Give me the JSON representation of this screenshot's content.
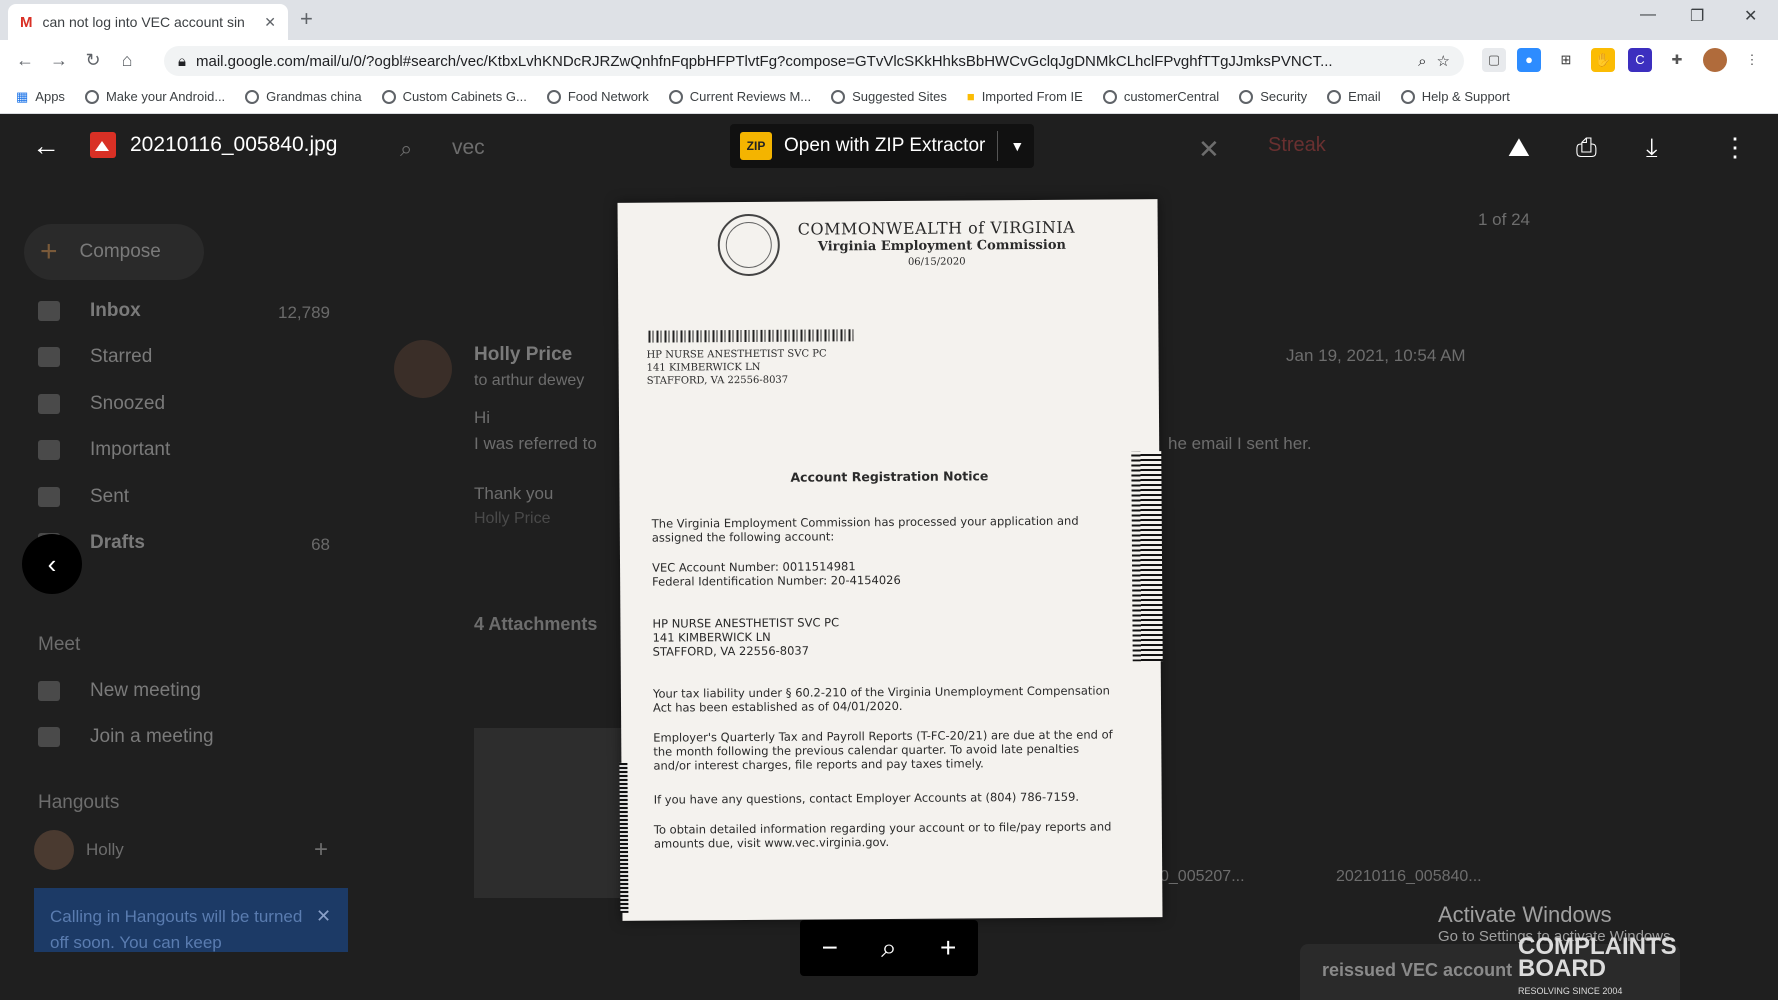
{
  "browser": {
    "tab_title": "can not log into VEC account sin",
    "gmail_mark": "M",
    "url": "mail.google.com/mail/u/0/?ogbl#search/vec/KtbxLvhKNDcRJRZwQnhfnFqpbHFPTlvtFg?compose=GTvVlcSKkHhksBbHWCvGclqJgDNMkCLhclFPvghfTTgJJmksPVNCT...",
    "bookmarks": [
      "Apps",
      "Make your Android...",
      "Grandmas china",
      "Custom Cabinets G...",
      "Food Network",
      "Current Reviews M...",
      "Suggested Sites",
      "Imported From IE",
      "customerCentral",
      "Security",
      "Email",
      "Help & Support"
    ]
  },
  "gmail": {
    "compose": "Compose",
    "nav": [
      {
        "label": "Inbox",
        "count": "12,789"
      },
      {
        "label": "Starred",
        "count": ""
      },
      {
        "label": "Snoozed",
        "count": ""
      },
      {
        "label": "Important",
        "count": ""
      },
      {
        "label": "Sent",
        "count": ""
      },
      {
        "label": "Drafts",
        "count": "68"
      }
    ],
    "meet": "Meet",
    "new_meeting": "New meeting",
    "join_meeting": "Join a meeting",
    "hangouts": "Hangouts",
    "hangouts_user": "Holly",
    "hangouts_banner": "Calling in Hangouts will be turned off soon. You can keep",
    "search_value": "vec",
    "sender": "Holly Price",
    "to": "to arthur dewey",
    "date": "Jan 19, 2021, 10:54 AM",
    "pagination": "1 of 24",
    "body_hi": "Hi",
    "body_line": "I was referred to",
    "body_line_end": "he email I sent her.",
    "thanks": "Thank you",
    "sig": "Holly Price",
    "attachments": "4 Attachments",
    "attach_name1": "0_005207...",
    "attach_name2": "20210116_005840...",
    "draft_title": "reissued VEC account"
  },
  "viewer": {
    "filename": "20210116_005840.jpg",
    "open_with": "Open with ZIP Extractor",
    "zip_icon": "ZIP"
  },
  "document": {
    "hdr1": "COMMONWEALTH of VIRGINIA",
    "hdr2": "Virginia Employment Commission",
    "date": "06/15/2020",
    "addr1": "HP NURSE ANESTHETIST SVC PC",
    "addr2": "141 KIMBERWICK LN",
    "addr3": "STAFFORD, VA 22556-8037",
    "title": "Account Registration Notice",
    "p1": "The Virginia Employment Commission has processed your application and assigned the following account:",
    "acct": "VEC Account Number: 0011514981",
    "fein": "Federal Identification Number: 20-4154026",
    "p2": "Your tax liability under § 60.2-210 of the Virginia Unemployment Compensation Act has been established as of 04/01/2020.",
    "p3": "Employer's Quarterly Tax and Payroll Reports (T-FC-20/21) are due at the end of the month following the previous calendar quarter. To avoid late penalties and/or interest charges, file reports and pay taxes timely.",
    "p4": "If you have any questions, contact Employer Accounts at (804) 786-7159.",
    "p5": "To obtain detailed information regarding your account or to file/pay reports and amounts due, visit www.vec.virginia.gov."
  },
  "watermark": {
    "line1": "Activate Windows",
    "line2": "Go to Settings to activate Windows.",
    "cb1": "COMPLAINTS",
    "cb2": "BOARD",
    "cb3": "RESOLVING SINCE 2004"
  }
}
